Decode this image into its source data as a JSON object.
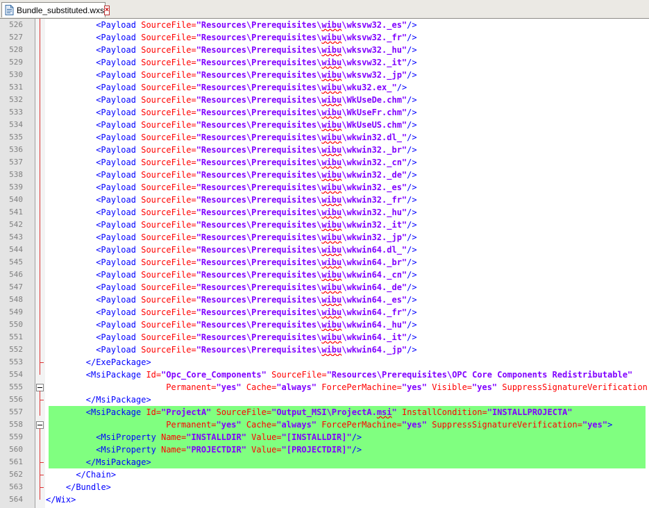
{
  "tab": {
    "title": "Bundle_substituted.wxs",
    "icon": "file-icon",
    "close_icon": "close-icon"
  },
  "colors": {
    "tag": "#0000ff",
    "attribute": "#ff0000",
    "value": "#8000ff",
    "highlight": "#80ff80"
  },
  "lines": [
    {
      "n": "526",
      "i": 5,
      "hl": false,
      "seg": [
        [
          "t",
          "<Payload "
        ],
        [
          "a",
          "SourceFile="
        ],
        [
          "v",
          "\"Resources\\Prerequisites\\wibu\\wksvw32._es\""
        ],
        [
          "t",
          "/>"
        ]
      ]
    },
    {
      "n": "527",
      "i": 5,
      "hl": false,
      "seg": [
        [
          "t",
          "<Payload "
        ],
        [
          "a",
          "SourceFile="
        ],
        [
          "v",
          "\"Resources\\Prerequisites\\wibu\\wksvw32._fr\""
        ],
        [
          "t",
          "/>"
        ]
      ]
    },
    {
      "n": "528",
      "i": 5,
      "hl": false,
      "seg": [
        [
          "t",
          "<Payload "
        ],
        [
          "a",
          "SourceFile="
        ],
        [
          "v",
          "\"Resources\\Prerequisites\\wibu\\wksvw32._hu\""
        ],
        [
          "t",
          "/>"
        ]
      ]
    },
    {
      "n": "529",
      "i": 5,
      "hl": false,
      "seg": [
        [
          "t",
          "<Payload "
        ],
        [
          "a",
          "SourceFile="
        ],
        [
          "v",
          "\"Resources\\Prerequisites\\wibu\\wksvw32._it\""
        ],
        [
          "t",
          "/>"
        ]
      ]
    },
    {
      "n": "530",
      "i": 5,
      "hl": false,
      "seg": [
        [
          "t",
          "<Payload "
        ],
        [
          "a",
          "SourceFile="
        ],
        [
          "v",
          "\"Resources\\Prerequisites\\wibu\\wksvw32._jp\""
        ],
        [
          "t",
          "/>"
        ]
      ]
    },
    {
      "n": "531",
      "i": 5,
      "hl": false,
      "seg": [
        [
          "t",
          "<Payload "
        ],
        [
          "a",
          "SourceFile="
        ],
        [
          "v",
          "\"Resources\\Prerequisites\\wibu\\wku32.ex_\""
        ],
        [
          "t",
          "/>"
        ]
      ]
    },
    {
      "n": "532",
      "i": 5,
      "hl": false,
      "seg": [
        [
          "t",
          "<Payload "
        ],
        [
          "a",
          "SourceFile="
        ],
        [
          "v",
          "\"Resources\\Prerequisites\\wibu\\WkUseDe.chm\""
        ],
        [
          "t",
          "/>"
        ]
      ]
    },
    {
      "n": "533",
      "i": 5,
      "hl": false,
      "seg": [
        [
          "t",
          "<Payload "
        ],
        [
          "a",
          "SourceFile="
        ],
        [
          "v",
          "\"Resources\\Prerequisites\\wibu\\WkUseFr.chm\""
        ],
        [
          "t",
          "/>"
        ]
      ]
    },
    {
      "n": "534",
      "i": 5,
      "hl": false,
      "seg": [
        [
          "t",
          "<Payload "
        ],
        [
          "a",
          "SourceFile="
        ],
        [
          "v",
          "\"Resources\\Prerequisites\\wibu\\WkUseUS.chm\""
        ],
        [
          "t",
          "/>"
        ]
      ]
    },
    {
      "n": "535",
      "i": 5,
      "hl": false,
      "seg": [
        [
          "t",
          "<Payload "
        ],
        [
          "a",
          "SourceFile="
        ],
        [
          "v",
          "\"Resources\\Prerequisites\\wibu\\wkwin32.dl_\""
        ],
        [
          "t",
          "/>"
        ]
      ]
    },
    {
      "n": "536",
      "i": 5,
      "hl": false,
      "seg": [
        [
          "t",
          "<Payload "
        ],
        [
          "a",
          "SourceFile="
        ],
        [
          "v",
          "\"Resources\\Prerequisites\\wibu\\wkwin32._br\""
        ],
        [
          "t",
          "/>"
        ]
      ]
    },
    {
      "n": "537",
      "i": 5,
      "hl": false,
      "seg": [
        [
          "t",
          "<Payload "
        ],
        [
          "a",
          "SourceFile="
        ],
        [
          "v",
          "\"Resources\\Prerequisites\\wibu\\wkwin32._cn\""
        ],
        [
          "t",
          "/>"
        ]
      ]
    },
    {
      "n": "538",
      "i": 5,
      "hl": false,
      "seg": [
        [
          "t",
          "<Payload "
        ],
        [
          "a",
          "SourceFile="
        ],
        [
          "v",
          "\"Resources\\Prerequisites\\wibu\\wkwin32._de\""
        ],
        [
          "t",
          "/>"
        ]
      ]
    },
    {
      "n": "539",
      "i": 5,
      "hl": false,
      "seg": [
        [
          "t",
          "<Payload "
        ],
        [
          "a",
          "SourceFile="
        ],
        [
          "v",
          "\"Resources\\Prerequisites\\wibu\\wkwin32._es\""
        ],
        [
          "t",
          "/>"
        ]
      ]
    },
    {
      "n": "540",
      "i": 5,
      "hl": false,
      "seg": [
        [
          "t",
          "<Payload "
        ],
        [
          "a",
          "SourceFile="
        ],
        [
          "v",
          "\"Resources\\Prerequisites\\wibu\\wkwin32._fr\""
        ],
        [
          "t",
          "/>"
        ]
      ]
    },
    {
      "n": "541",
      "i": 5,
      "hl": false,
      "seg": [
        [
          "t",
          "<Payload "
        ],
        [
          "a",
          "SourceFile="
        ],
        [
          "v",
          "\"Resources\\Prerequisites\\wibu\\wkwin32._hu\""
        ],
        [
          "t",
          "/>"
        ]
      ]
    },
    {
      "n": "542",
      "i": 5,
      "hl": false,
      "seg": [
        [
          "t",
          "<Payload "
        ],
        [
          "a",
          "SourceFile="
        ],
        [
          "v",
          "\"Resources\\Prerequisites\\wibu\\wkwin32._it\""
        ],
        [
          "t",
          "/>"
        ]
      ]
    },
    {
      "n": "543",
      "i": 5,
      "hl": false,
      "seg": [
        [
          "t",
          "<Payload "
        ],
        [
          "a",
          "SourceFile="
        ],
        [
          "v",
          "\"Resources\\Prerequisites\\wibu\\wkwin32._jp\""
        ],
        [
          "t",
          "/>"
        ]
      ]
    },
    {
      "n": "544",
      "i": 5,
      "hl": false,
      "seg": [
        [
          "t",
          "<Payload "
        ],
        [
          "a",
          "SourceFile="
        ],
        [
          "v",
          "\"Resources\\Prerequisites\\wibu\\wkwin64.dl_\""
        ],
        [
          "t",
          "/>"
        ]
      ]
    },
    {
      "n": "545",
      "i": 5,
      "hl": false,
      "seg": [
        [
          "t",
          "<Payload "
        ],
        [
          "a",
          "SourceFile="
        ],
        [
          "v",
          "\"Resources\\Prerequisites\\wibu\\wkwin64._br\""
        ],
        [
          "t",
          "/>"
        ]
      ]
    },
    {
      "n": "546",
      "i": 5,
      "hl": false,
      "seg": [
        [
          "t",
          "<Payload "
        ],
        [
          "a",
          "SourceFile="
        ],
        [
          "v",
          "\"Resources\\Prerequisites\\wibu\\wkwin64._cn\""
        ],
        [
          "t",
          "/>"
        ]
      ]
    },
    {
      "n": "547",
      "i": 5,
      "hl": false,
      "seg": [
        [
          "t",
          "<Payload "
        ],
        [
          "a",
          "SourceFile="
        ],
        [
          "v",
          "\"Resources\\Prerequisites\\wibu\\wkwin64._de\""
        ],
        [
          "t",
          "/>"
        ]
      ]
    },
    {
      "n": "548",
      "i": 5,
      "hl": false,
      "seg": [
        [
          "t",
          "<Payload "
        ],
        [
          "a",
          "SourceFile="
        ],
        [
          "v",
          "\"Resources\\Prerequisites\\wibu\\wkwin64._es\""
        ],
        [
          "t",
          "/>"
        ]
      ]
    },
    {
      "n": "549",
      "i": 5,
      "hl": false,
      "seg": [
        [
          "t",
          "<Payload "
        ],
        [
          "a",
          "SourceFile="
        ],
        [
          "v",
          "\"Resources\\Prerequisites\\wibu\\wkwin64._fr\""
        ],
        [
          "t",
          "/>"
        ]
      ]
    },
    {
      "n": "550",
      "i": 5,
      "hl": false,
      "seg": [
        [
          "t",
          "<Payload "
        ],
        [
          "a",
          "SourceFile="
        ],
        [
          "v",
          "\"Resources\\Prerequisites\\wibu\\wkwin64._hu\""
        ],
        [
          "t",
          "/>"
        ]
      ]
    },
    {
      "n": "551",
      "i": 5,
      "hl": false,
      "seg": [
        [
          "t",
          "<Payload "
        ],
        [
          "a",
          "SourceFile="
        ],
        [
          "v",
          "\"Resources\\Prerequisites\\wibu\\wkwin64._it\""
        ],
        [
          "t",
          "/>"
        ]
      ]
    },
    {
      "n": "552",
      "i": 5,
      "hl": false,
      "seg": [
        [
          "t",
          "<Payload "
        ],
        [
          "a",
          "SourceFile="
        ],
        [
          "v",
          "\"Resources\\Prerequisites\\wibu\\wkwin64._jp\""
        ],
        [
          "t",
          "/>"
        ]
      ]
    },
    {
      "n": "553",
      "i": 4,
      "hl": false,
      "seg": [
        [
          "t",
          "</ExePackage>"
        ]
      ]
    },
    {
      "n": "554",
      "i": 4,
      "hl": false,
      "seg": [
        [
          "t",
          "<MsiPackage "
        ],
        [
          "a",
          "Id="
        ],
        [
          "v",
          "\"Opc_Core_Components\""
        ],
        [
          "t",
          " "
        ],
        [
          "a",
          "SourceFile="
        ],
        [
          "v",
          "\"Resources\\Prerequisites\\OPC Core Components Redistributable\""
        ]
      ]
    },
    {
      "n": "555",
      "i": 12,
      "hl": false,
      "seg": [
        [
          "a",
          "Permanent="
        ],
        [
          "v",
          "\"yes\""
        ],
        [
          "t",
          " "
        ],
        [
          "a",
          "Cache="
        ],
        [
          "v",
          "\"always\""
        ],
        [
          "t",
          " "
        ],
        [
          "a",
          "ForcePerMachine="
        ],
        [
          "v",
          "\"yes\""
        ],
        [
          "t",
          " "
        ],
        [
          "a",
          "Visible="
        ],
        [
          "v",
          "\"yes\""
        ],
        [
          "t",
          " "
        ],
        [
          "a",
          "SuppressSignatureVerification"
        ]
      ]
    },
    {
      "n": "556",
      "i": 4,
      "hl": false,
      "seg": [
        [
          "t",
          "</MsiPackage>"
        ]
      ]
    },
    {
      "n": "557",
      "i": 4,
      "hl": true,
      "seg": [
        [
          "t",
          "<MsiPackage "
        ],
        [
          "a",
          "Id="
        ],
        [
          "v",
          "\"ProjectA\""
        ],
        [
          "t",
          " "
        ],
        [
          "a",
          "SourceFile="
        ],
        [
          "v",
          "\"Output_MSI\\ProjectA.msi\""
        ],
        [
          "t",
          " "
        ],
        [
          "a",
          "InstallCondition="
        ],
        [
          "v",
          "\"INSTALLPROJECTA\""
        ]
      ]
    },
    {
      "n": "558",
      "i": 12,
      "hl": true,
      "seg": [
        [
          "a",
          "Permanent="
        ],
        [
          "v",
          "\"yes\""
        ],
        [
          "t",
          " "
        ],
        [
          "a",
          "Cache="
        ],
        [
          "v",
          "\"always\""
        ],
        [
          "t",
          " "
        ],
        [
          "a",
          "ForcePerMachine="
        ],
        [
          "v",
          "\"yes\""
        ],
        [
          "t",
          " "
        ],
        [
          "a",
          "SuppressSignatureVerification="
        ],
        [
          "v",
          "\"yes\""
        ],
        [
          "t",
          ">"
        ]
      ]
    },
    {
      "n": "559",
      "i": 5,
      "hl": true,
      "seg": [
        [
          "t",
          "<MsiProperty "
        ],
        [
          "a",
          "Name="
        ],
        [
          "v",
          "\"INSTALLDIR\""
        ],
        [
          "t",
          " "
        ],
        [
          "a",
          "Value="
        ],
        [
          "v",
          "\"[INSTALLDIR]\""
        ],
        [
          "t",
          "/>"
        ]
      ]
    },
    {
      "n": "560",
      "i": 5,
      "hl": true,
      "seg": [
        [
          "t",
          "<MsiProperty "
        ],
        [
          "a",
          "Name="
        ],
        [
          "v",
          "\"PROJECTDIR\""
        ],
        [
          "t",
          " "
        ],
        [
          "a",
          "Value="
        ],
        [
          "v",
          "\"[PROJECTDIR]\""
        ],
        [
          "t",
          "/>"
        ]
      ]
    },
    {
      "n": "561",
      "i": 4,
      "hl": true,
      "seg": [
        [
          "t",
          "</MsiPackage>"
        ]
      ]
    },
    {
      "n": "562",
      "i": 3,
      "hl": false,
      "seg": [
        [
          "t",
          "</Chain>"
        ]
      ]
    },
    {
      "n": "563",
      "i": 2,
      "hl": false,
      "seg": [
        [
          "t",
          "</Bundle>"
        ]
      ]
    },
    {
      "n": "564",
      "i": 0,
      "hl": false,
      "seg": [
        [
          "t",
          "</Wix>"
        ]
      ]
    }
  ]
}
